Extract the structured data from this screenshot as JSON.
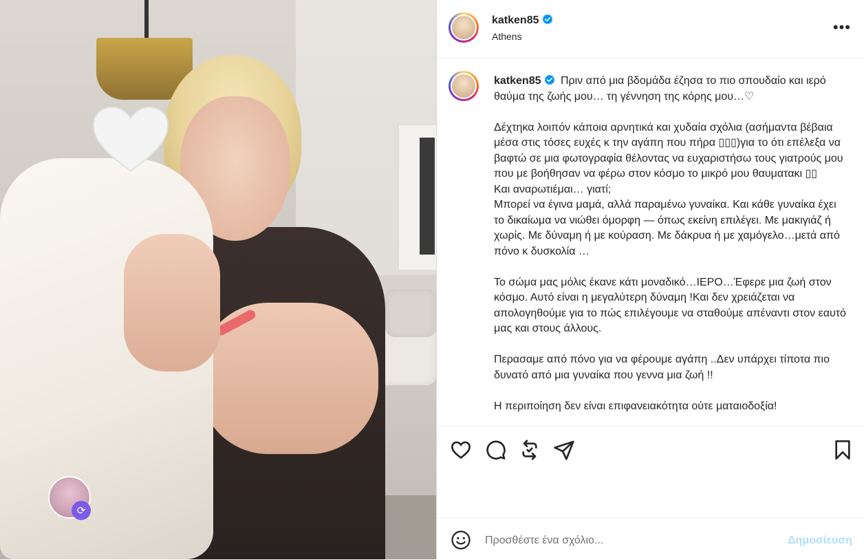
{
  "post": {
    "username": "katken85",
    "location": "Athens",
    "more_icon": "more-horizontal-icon",
    "verified_icon": "verified-badge-icon"
  },
  "caption": {
    "username": "katken85",
    "text": "Πριν από μια βδομάδα έζησα το πιο σπουδαίο και ιερό θαύμα της ζωής μου… τη γέννηση της κόρης μου…♡\n\nΔέχτηκα λοιπόν κάποια αρνητικά και χυδαία σχόλια (ασήμαντα βέβαια μέσα στις τόσες ευχές κ την αγάπη που πήρα ▯▯▯)για το ότι επέλεξα να βαφτώ σε μια φωτογραφία θέλοντας να ευχαριστήσω τους γιατρούς μου που με βοήθησαν να φέρω στον κόσμο το μικρό μου θαυματακι ▯▯\nΚαι αναρωτιέμαι… γιατί;\nΜπορεί να έγινα μαμά, αλλά παραμένω γυναίκα. Και κάθε γυναίκα έχει το δικαίωμα να νιώθει όμορφη — όπως εκείνη επιλέγει. Με μακιγιάζ ή χωρίς. Με δύναμη ή με κούραση. Με δάκρυα ή με χαμόγελο…μετά από πόνο κ δυσκολία …\n\nΤο σώμα μας μόλις έκανε κάτι μοναδικό…ΙΕΡΟ…Έφερε μια ζωή στον κόσμο. Αυτό είναι η μεγαλύτερη δύναμη !Και δεν χρειάζεται να απολογηθούμε για το πώς επιλέγουμε να σταθούμε απέναντι στον εαυτό μας και στους άλλους.\n\nΠερασαμε από πόνο για να φέρουμε αγάπη ..Δεν υπάρχει τίποτα πιο δυνατό από μια γυναίκα που γεννα μια ζωή !!\n\nΗ περιποίηση δεν είναι επιφανειακότητα ούτε ματαιοδοξία!"
  },
  "actions": {
    "like_icon": "heart-icon",
    "comment_icon": "comment-icon",
    "repost_icon": "repost-icon",
    "share_icon": "send-icon",
    "save_icon": "bookmark-icon"
  },
  "add_comment": {
    "emoji_icon": "emoji-icon",
    "placeholder": "Προσθέστε ένα σχόλιο...",
    "post_label": "Δημοσίευση",
    "post_color": "#b2dffc"
  },
  "media": {
    "heart_sticker_icon": "white-heart-sticker-icon",
    "story_badge_icon": "repost-badge-icon"
  }
}
